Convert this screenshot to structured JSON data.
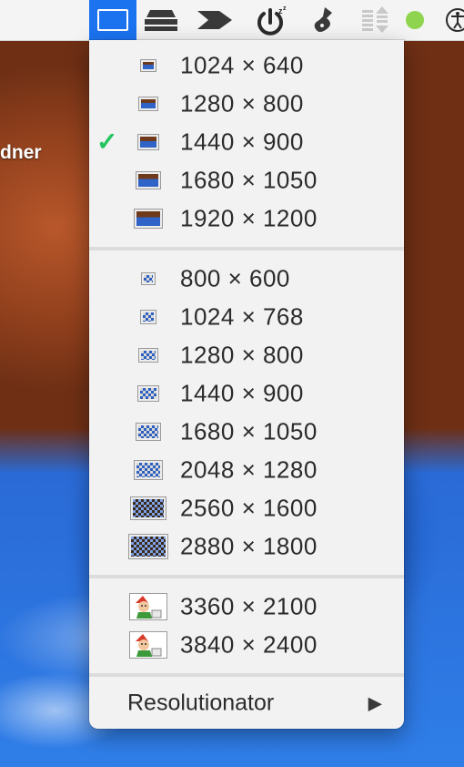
{
  "desktop": {
    "partial_label": "dner"
  },
  "menubar": {
    "icons": [
      "display-icon",
      "layers-icon",
      "arrow-icon",
      "sleep-power-icon",
      "guitar-icon",
      "equalizer-icon",
      "green-dot-icon",
      "accessibility-icon"
    ],
    "status_dot_color": "#8fd44f",
    "active_color": "#1b73f0"
  },
  "menu": {
    "selected_item": "1440 × 900",
    "check_symbol": "✓",
    "section1": [
      {
        "label": "1024 × 640"
      },
      {
        "label": "1280 × 800"
      },
      {
        "label": "1440 × 900"
      },
      {
        "label": "1680 × 1050"
      },
      {
        "label": "1920 × 1200"
      }
    ],
    "section2": [
      {
        "label": "800 × 600"
      },
      {
        "label": "1024 × 768"
      },
      {
        "label": "1280 × 800"
      },
      {
        "label": "1440 × 900"
      },
      {
        "label": "1680 × 1050"
      },
      {
        "label": "2048 × 1280"
      },
      {
        "label": "2560 × 1600"
      },
      {
        "label": "2880 × 1800"
      }
    ],
    "section3": [
      {
        "label": "3360 × 2100"
      },
      {
        "label": "3840 × 2400"
      }
    ],
    "footer": {
      "label": "Resolutionator",
      "arrow": "▶"
    }
  }
}
